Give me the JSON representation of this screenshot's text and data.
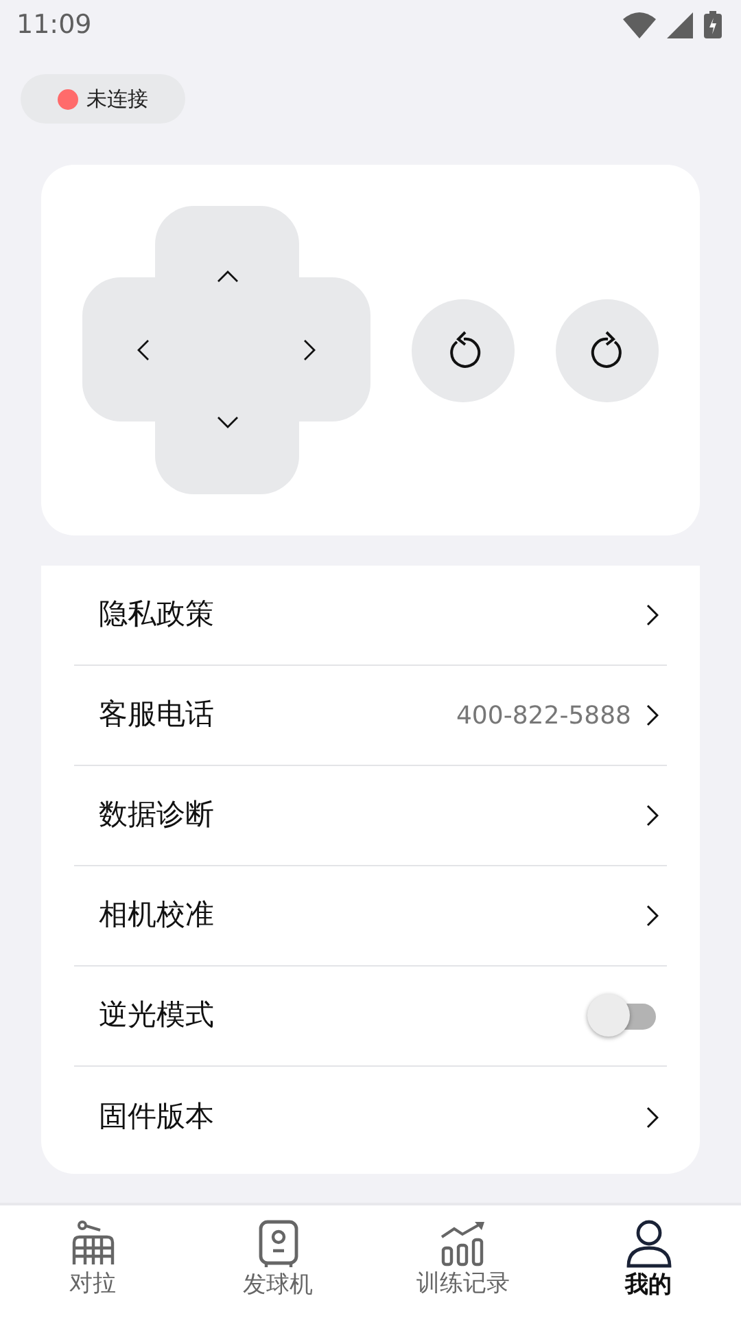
{
  "status_bar": {
    "time": "11:09"
  },
  "connection": {
    "label": "未连接",
    "color": "#ff6b6b"
  },
  "settings": [
    {
      "kind": "link",
      "label": "隐私政策"
    },
    {
      "kind": "link",
      "label": "客服电话",
      "value": "400-822-5888"
    },
    {
      "kind": "link",
      "label": "数据诊断"
    },
    {
      "kind": "link",
      "label": "相机校准"
    },
    {
      "kind": "toggle",
      "label": "逆光模式",
      "on": false
    },
    {
      "kind": "link",
      "label": "固件版本"
    }
  ],
  "tabs": [
    {
      "label": "对拉",
      "selected": false
    },
    {
      "label": "发球机",
      "selected": false
    },
    {
      "label": "训练记录",
      "selected": false
    },
    {
      "label": "我的",
      "selected": true
    }
  ]
}
